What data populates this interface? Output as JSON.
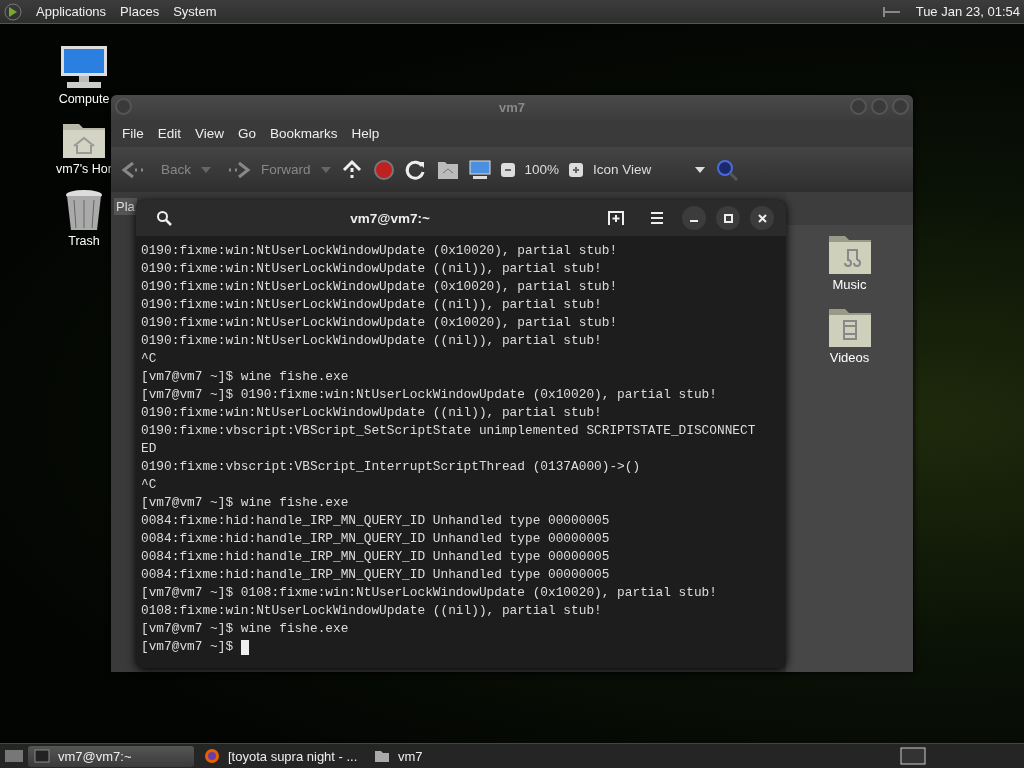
{
  "top_panel": {
    "menus": [
      "Applications",
      "Places",
      "System"
    ],
    "clock": "Tue Jan 23, 01:54"
  },
  "desktop_icons": [
    {
      "label": "Compute",
      "kind": "computer"
    },
    {
      "label": "vm7's Hor",
      "kind": "home"
    },
    {
      "label": "Trash",
      "kind": "trash"
    }
  ],
  "file_manager": {
    "title": "vm7",
    "menu": [
      "File",
      "Edit",
      "View",
      "Go",
      "Bookmarks",
      "Help"
    ],
    "toolbar": {
      "back": "Back",
      "forward": "Forward",
      "zoom": "100%",
      "view": "Icon View"
    },
    "sidebar_tab": "Pla",
    "items": [
      {
        "label": "Music",
        "kind": "music"
      },
      {
        "label": "Videos",
        "kind": "videos"
      }
    ]
  },
  "terminal": {
    "title": "vm7@vm7:~",
    "lines": [
      "0190:fixme:win:NtUserLockWindowUpdate (0x10020), partial stub!",
      "0190:fixme:win:NtUserLockWindowUpdate ((nil)), partial stub!",
      "0190:fixme:win:NtUserLockWindowUpdate (0x10020), partial stub!",
      "0190:fixme:win:NtUserLockWindowUpdate ((nil)), partial stub!",
      "0190:fixme:win:NtUserLockWindowUpdate (0x10020), partial stub!",
      "0190:fixme:win:NtUserLockWindowUpdate ((nil)), partial stub!",
      "^C",
      "[vm7@vm7 ~]$ wine fishe.exe",
      "[vm7@vm7 ~]$ 0190:fixme:win:NtUserLockWindowUpdate (0x10020), partial stub!",
      "0190:fixme:win:NtUserLockWindowUpdate ((nil)), partial stub!",
      "0190:fixme:vbscript:VBScript_SetScriptState unimplemented SCRIPTSTATE_DISCONNECT",
      "ED",
      "0190:fixme:vbscript:VBScript_InterruptScriptThread (0137A000)->()",
      "^C",
      "[vm7@vm7 ~]$ wine fishe.exe",
      "0084:fixme:hid:handle_IRP_MN_QUERY_ID Unhandled type 00000005",
      "0084:fixme:hid:handle_IRP_MN_QUERY_ID Unhandled type 00000005",
      "0084:fixme:hid:handle_IRP_MN_QUERY_ID Unhandled type 00000005",
      "0084:fixme:hid:handle_IRP_MN_QUERY_ID Unhandled type 00000005",
      "[vm7@vm7 ~]$ 0108:fixme:win:NtUserLockWindowUpdate (0x10020), partial stub!",
      "0108:fixme:win:NtUserLockWindowUpdate ((nil)), partial stub!",
      "[vm7@vm7 ~]$ wine fishe.exe",
      "[vm7@vm7 ~]$ "
    ]
  },
  "taskbar": {
    "tasks": [
      {
        "label": "vm7@vm7:~",
        "kind": "terminal",
        "selected": true
      },
      {
        "label": "[toyota supra night - ...",
        "kind": "browser",
        "selected": false
      },
      {
        "label": "vm7",
        "kind": "folder",
        "selected": false
      }
    ]
  }
}
